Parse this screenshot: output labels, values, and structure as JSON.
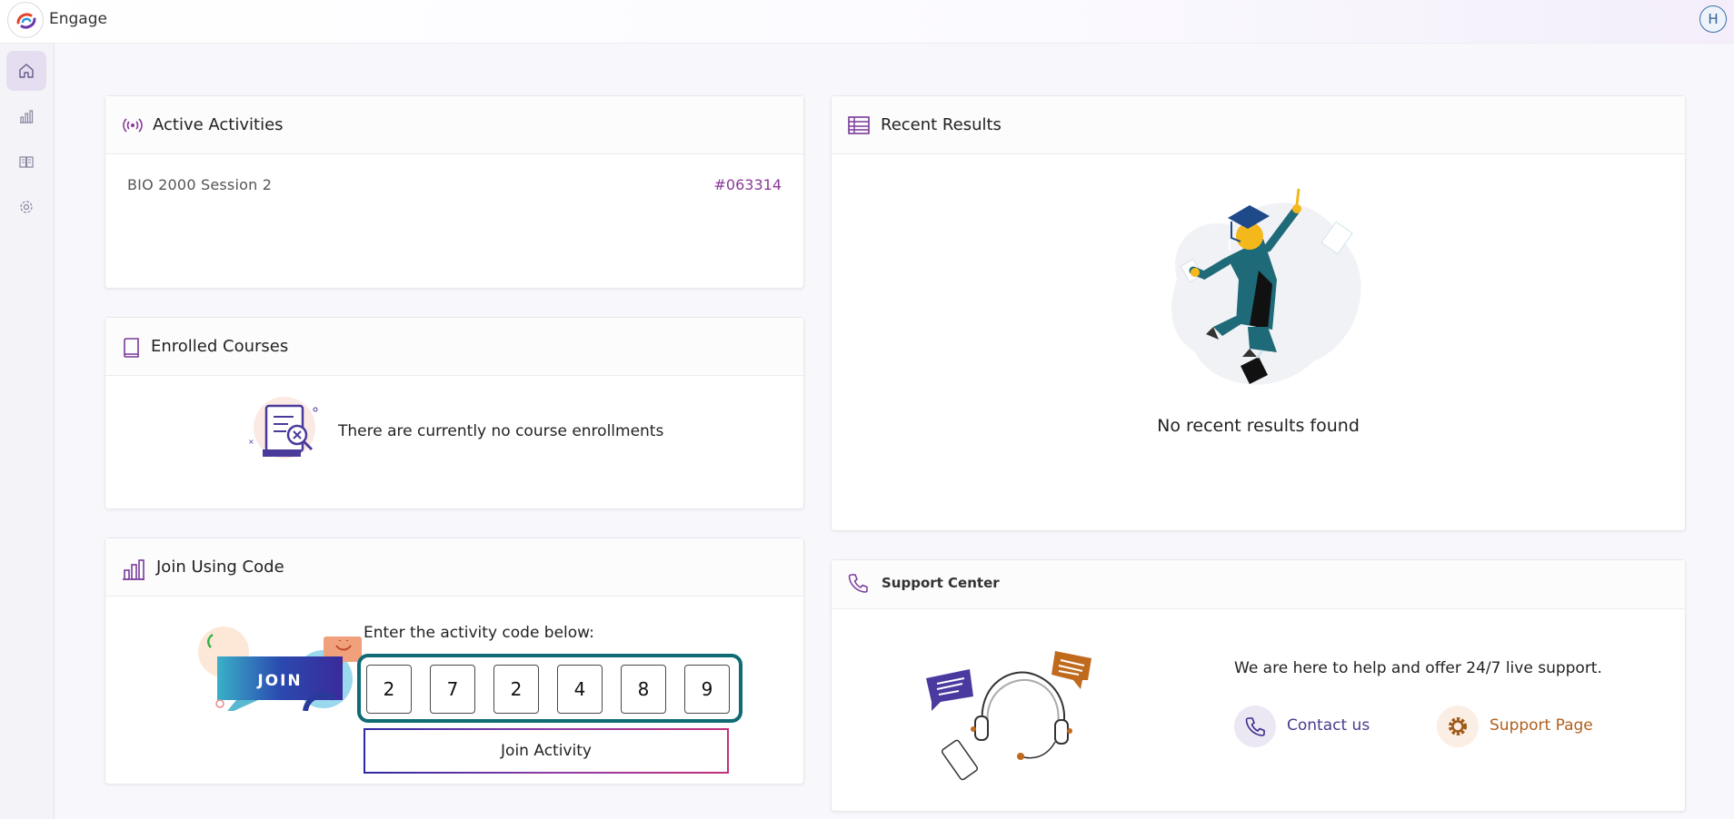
{
  "app": {
    "title": "Engage",
    "user_initial": "H"
  },
  "sidebar": {
    "items": [
      {
        "name": "home",
        "icon": "home-icon",
        "active": true
      },
      {
        "name": "analytics",
        "icon": "bar-chart-icon",
        "active": false
      },
      {
        "name": "courses",
        "icon": "book-open-icon",
        "active": false
      },
      {
        "name": "settings",
        "icon": "gear-icon",
        "active": false
      }
    ]
  },
  "active_activities": {
    "title": "Active Activities",
    "items": [
      {
        "name": "BIO 2000 Session 2",
        "code": "#063314"
      }
    ]
  },
  "enrolled_courses": {
    "title": "Enrolled Courses",
    "empty_message": "There are currently no course enrollments"
  },
  "join_code": {
    "title": "Join Using Code",
    "illustration_text": "JOIN",
    "prompt": "Enter the activity code below:",
    "digits": [
      "2",
      "7",
      "2",
      "4",
      "8",
      "9"
    ],
    "button_label": "Join Activity"
  },
  "recent_results": {
    "title": "Recent Results",
    "empty_message": "No recent results found"
  },
  "support": {
    "title": "Support Center",
    "message": "We are here to help and offer 24/7 live support.",
    "contact_label": "Contact us",
    "support_page_label": "Support Page"
  },
  "colors": {
    "accent_purple": "#8a3a9a",
    "code_border": "#0f6b74",
    "support_orange": "#b0601c",
    "contact_purple": "#4a3a8c"
  }
}
